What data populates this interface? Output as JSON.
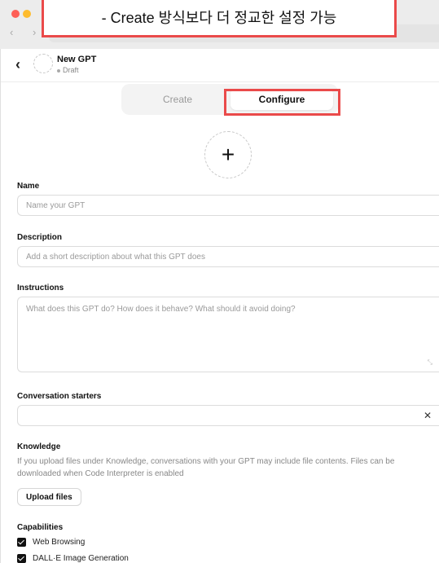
{
  "banner": {
    "text": "- Create 방식보다 더 정교한 설정 가능"
  },
  "header": {
    "title": "New GPT",
    "status": "Draft"
  },
  "tabs": [
    {
      "label": "Create",
      "active": false
    },
    {
      "label": "Configure",
      "active": true
    }
  ],
  "form": {
    "name_label": "Name",
    "name_placeholder": "Name your GPT",
    "description_label": "Description",
    "description_placeholder": "Add a short description about what this GPT does",
    "instructions_label": "Instructions",
    "instructions_placeholder": "What does this GPT do? How does it behave? What should it avoid doing?",
    "starters_label": "Conversation starters",
    "knowledge_label": "Knowledge",
    "knowledge_help": "If you upload files under Knowledge, conversations with your GPT may include file contents. Files can be downloaded when Code Interpreter is enabled",
    "upload_button": "Upload files",
    "capabilities_label": "Capabilities",
    "capabilities": [
      {
        "label": "Web Browsing",
        "checked": true
      },
      {
        "label": "DALL·E Image Generation",
        "checked": true
      }
    ]
  },
  "colors": {
    "highlight": "#ea4a4a",
    "checkbox": "#111111"
  }
}
